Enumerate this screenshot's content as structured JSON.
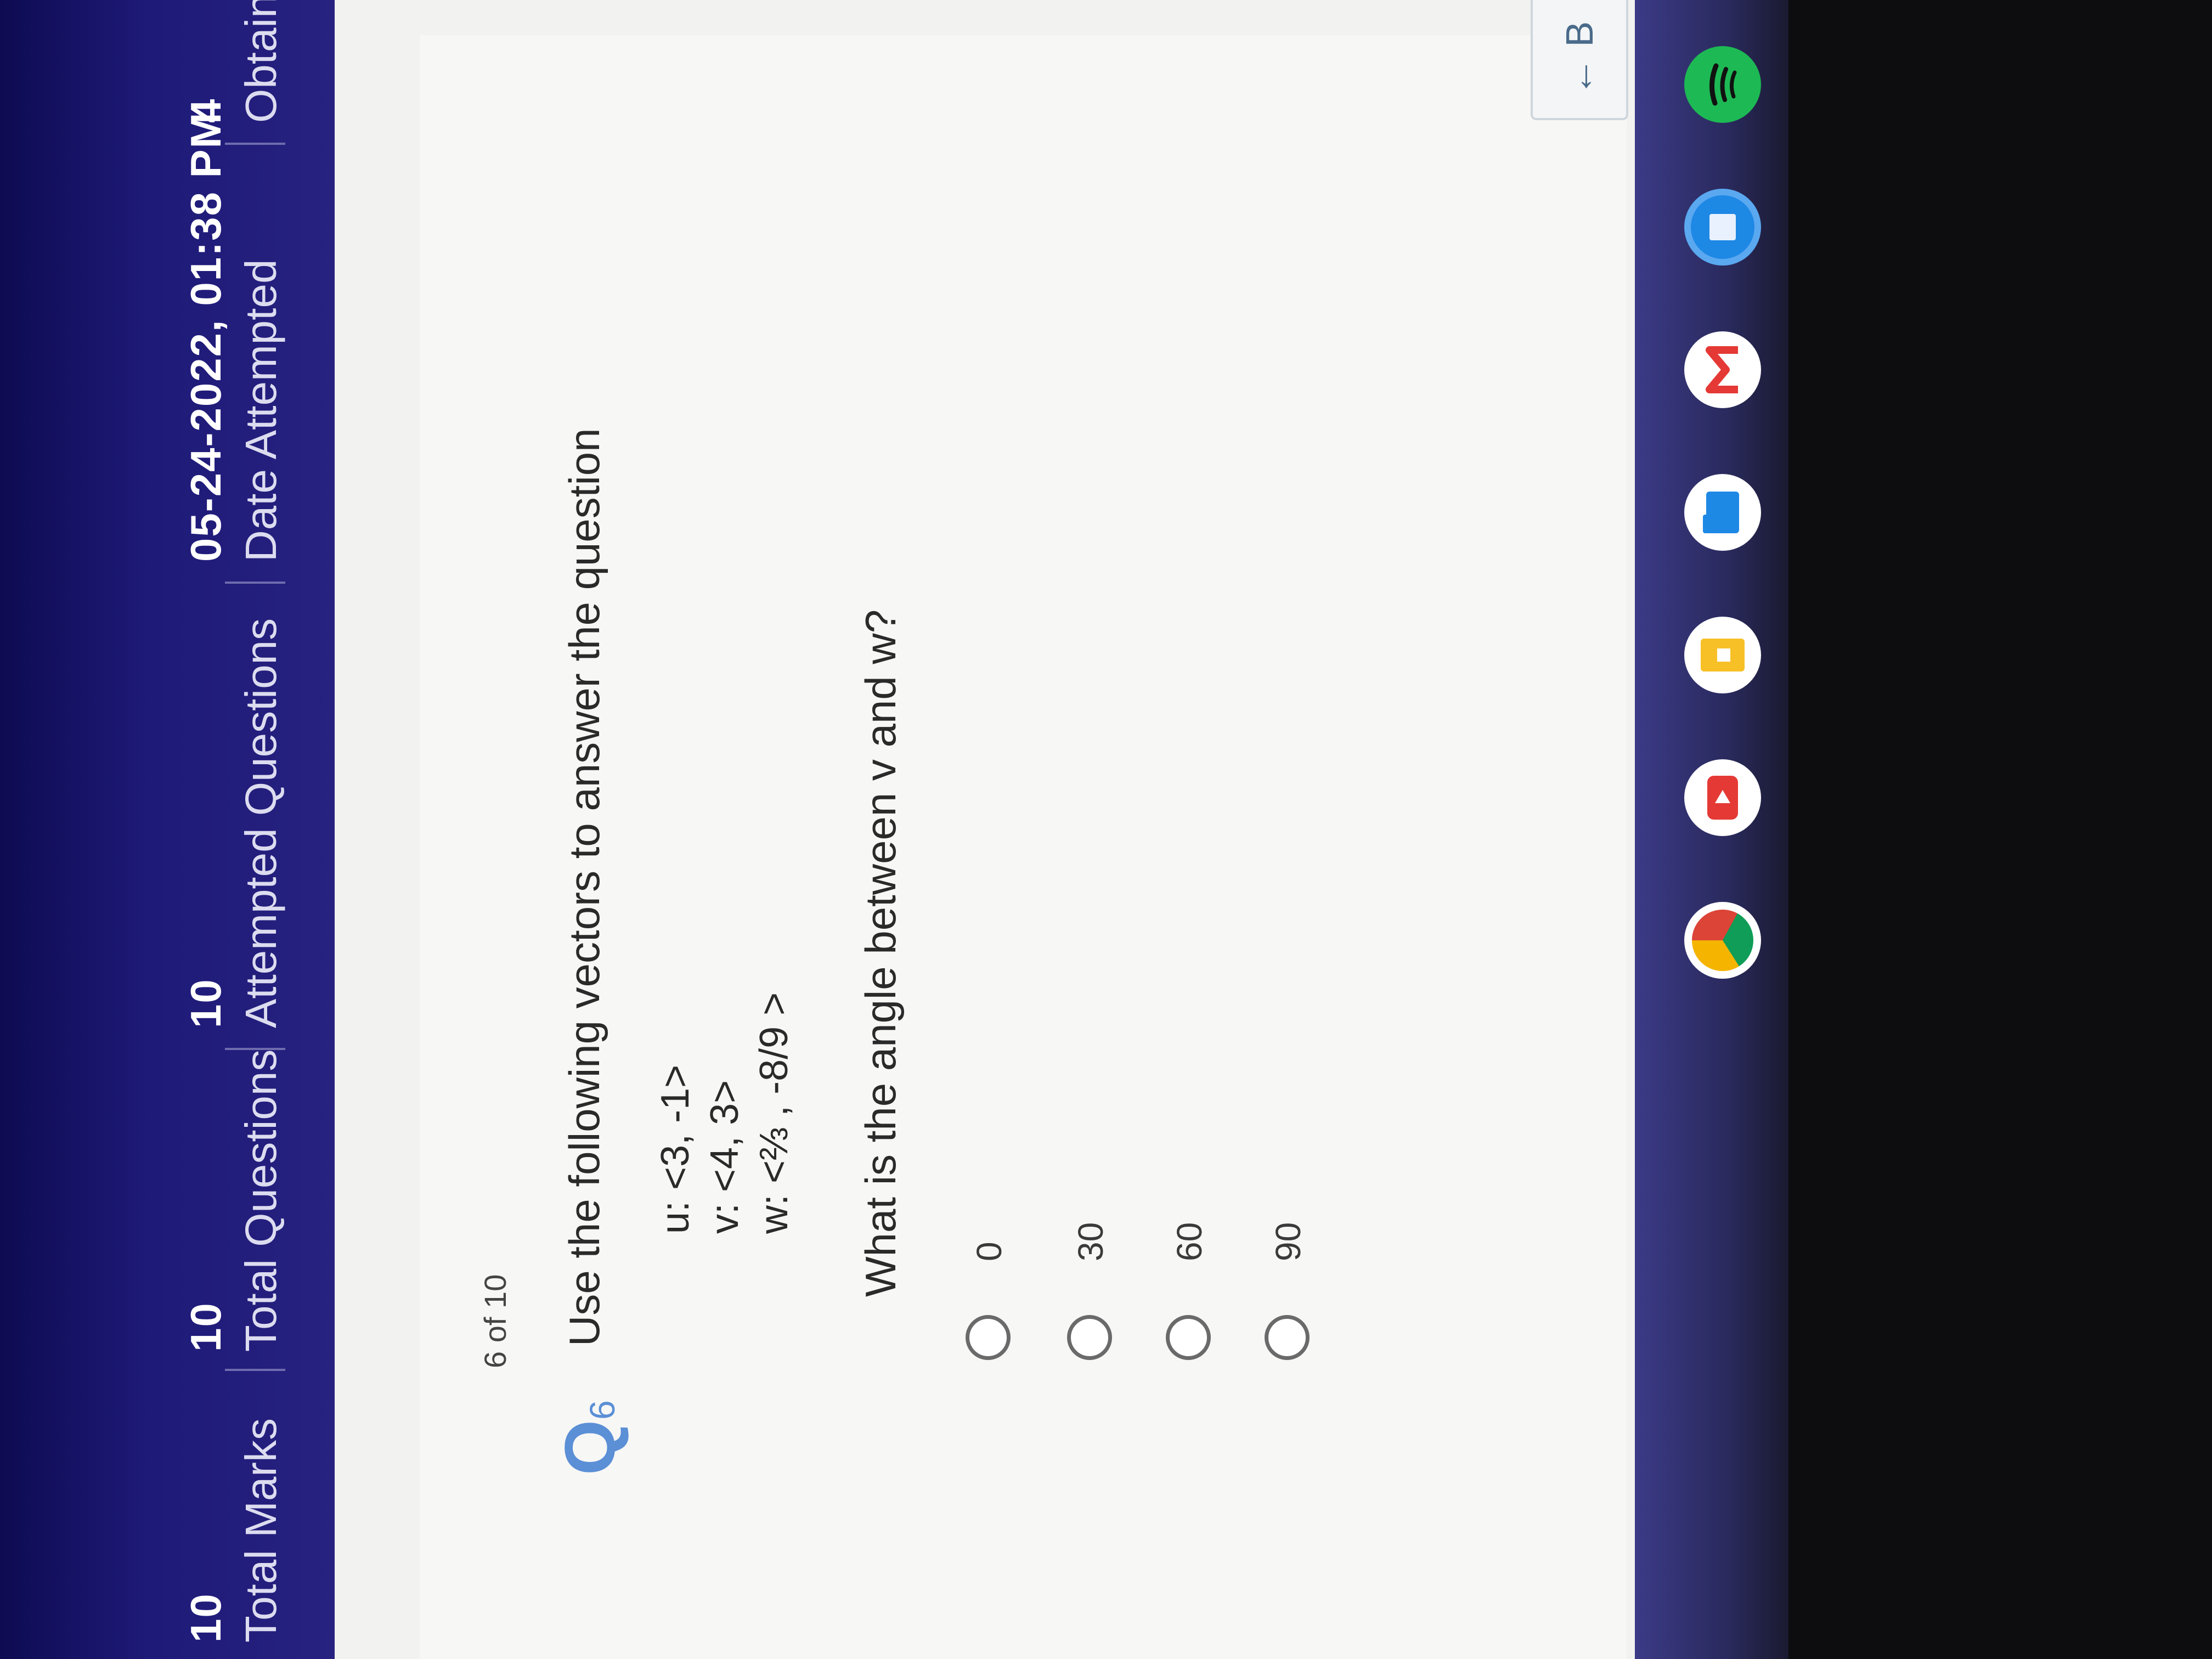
{
  "stats": [
    {
      "value": "10",
      "label": "Total Marks"
    },
    {
      "value": "10",
      "label": "Total Questions"
    },
    {
      "value": "10",
      "label": "Attempted Questions"
    },
    {
      "value": "05-24-2022, 01:38 PM",
      "label": "Date Attempted"
    },
    {
      "value": "4",
      "label": "Obtained"
    }
  ],
  "question": {
    "badge_letter": "Q",
    "badge_number": "6",
    "prompt": "Use the following vectors to answer the question",
    "vectors": [
      "u: <3, -1>",
      "v: <4, 3>",
      "w: <⅔ , -8/9 >"
    ],
    "main": "What is the angle between v and w?",
    "options": [
      "0",
      "30",
      "60",
      "90"
    ],
    "progress": "6 of 10"
  },
  "nav": {
    "back_label": "← B"
  },
  "colors": {
    "header_bg": "#1e1a78",
    "badge": "#5b8fd6",
    "shelf": "#3b3a86"
  },
  "shelf_apps": [
    "chrome-icon",
    "youtube-icon",
    "keep-icon",
    "files-icon",
    "gmail-icon",
    "docs-icon",
    "spotify-icon",
    "play-store-icon"
  ]
}
